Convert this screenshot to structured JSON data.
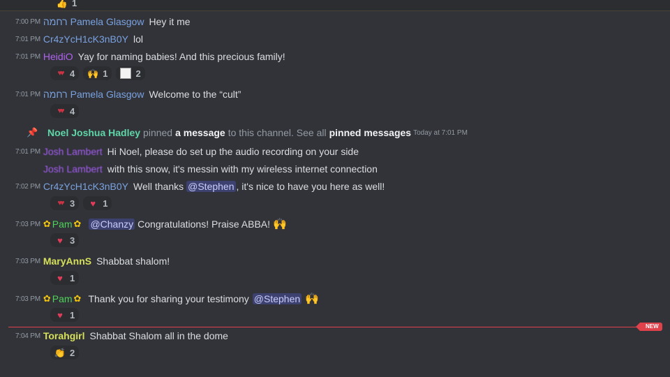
{
  "top_reaction": {
    "icon": "thumbs-up-icon",
    "count": "1"
  },
  "messages": [
    {
      "time": "7:00 PM",
      "prefix": "רחמה",
      "author": "Pamela Glasgow",
      "author_color": "#7aa2e0",
      "text": "Hey it me"
    },
    {
      "time": "7:01 PM",
      "prefix": "",
      "author": "Cr4zYcH1cK3nB0Y",
      "author_color": "#7aa2e0",
      "text": "lol"
    },
    {
      "time": "7:01 PM",
      "prefix": "",
      "author": "HeidiO",
      "author_color": "#b063f0",
      "text": "Yay for naming babies! And this precious family!",
      "reactions": [
        {
          "icon": "hearts-icon",
          "count": "4"
        },
        {
          "icon": "raised-hands-icon",
          "count": "1"
        },
        {
          "icon": "image-emoji-icon",
          "count": "2"
        }
      ]
    },
    {
      "time": "7:01 PM",
      "prefix": "רחמה",
      "author": "Pamela Glasgow",
      "author_color": "#7aa2e0",
      "text": "Welcome to the “cult”",
      "reactions": [
        {
          "icon": "hearts-icon",
          "count": "4"
        }
      ]
    },
    {
      "time": "7:01 PM",
      "prefix": "",
      "author": "Josh Lambert",
      "author_color": "#a45cf0",
      "text": "Hi Noel, please do set up the audio recording on your side"
    },
    {
      "time": "",
      "prefix": "",
      "author": "Josh Lambert",
      "author_color": "#a45cf0",
      "text": "with this snow, it's messin with my wireless internet connection"
    },
    {
      "time": "7:02 PM",
      "prefix": "",
      "author": "Cr4zYcH1cK3nB0Y",
      "author_color": "#7aa2e0",
      "text_before": "Well thanks",
      "mention": "@Stephen",
      "text": ", it's nice to have you here as well!",
      "reactions": [
        {
          "icon": "hearts-icon",
          "count": "3"
        },
        {
          "icon": "heart-icon",
          "count": "1"
        }
      ]
    },
    {
      "time": "7:03 PM",
      "prefix": "",
      "author": "Pam",
      "author_color": "#4fd25a",
      "mention_first": "@Chanzy",
      "text": "Congratulations! Praise ABBA!",
      "reactions": [
        {
          "icon": "heart-icon",
          "count": "3"
        }
      ]
    },
    {
      "time": "7:03 PM",
      "prefix": "",
      "author": "MaryAnnS",
      "author_color": "#d6e05a",
      "text": "Shabbat shalom!",
      "reactions": [
        {
          "icon": "heart-icon",
          "count": "1"
        }
      ]
    },
    {
      "time": "7:03 PM",
      "prefix": "",
      "author": "Pam",
      "author_color": "#4fd25a",
      "text": "Thank you for sharing your testimony",
      "mention_after": "@Stephen",
      "reactions": [
        {
          "icon": "heart-icon",
          "count": "1"
        }
      ]
    },
    {
      "time": "7:04 PM",
      "prefix": "",
      "author": "Torahgirl",
      "author_color": "#d6e05a",
      "text": "Shabbat Shalom all in the dome",
      "reactions": [
        {
          "icon": "clapping-hands-icon",
          "count": "2"
        }
      ]
    }
  ],
  "pin_notice": {
    "author": "Noel Joshua Hadley",
    "author_color": "#5fd6a8",
    "t1": "pinned",
    "link": "a message",
    "t2": "to this channel. See all",
    "link2": "pinned messages",
    "time": "Today at 7:01 PM"
  },
  "new_badge": "NEW"
}
